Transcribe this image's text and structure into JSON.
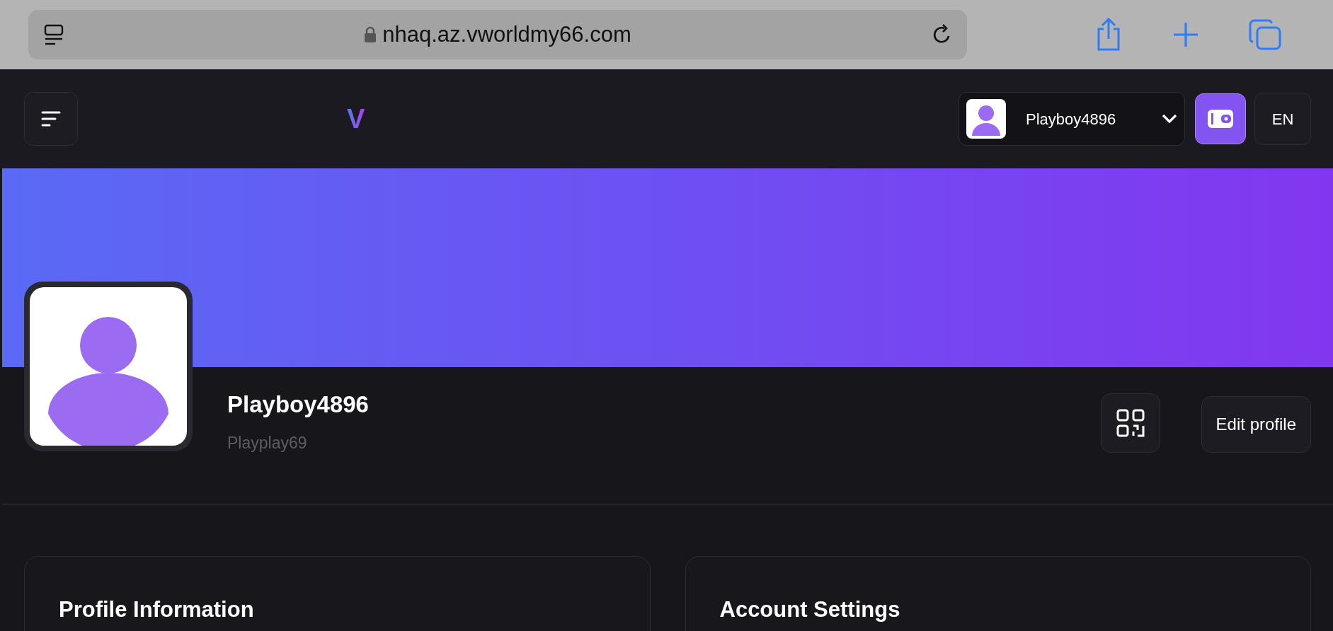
{
  "browser": {
    "url": "nhaq.az.vworldmy66.com"
  },
  "header": {
    "logo": "V",
    "user": {
      "name": "Playboy4896"
    },
    "language": "EN"
  },
  "profile": {
    "display_name": "Playboy4896",
    "username": "Playplay69",
    "edit_button": "Edit profile"
  },
  "cards": [
    {
      "title": "Profile Information"
    },
    {
      "title": "Account Settings"
    }
  ]
}
